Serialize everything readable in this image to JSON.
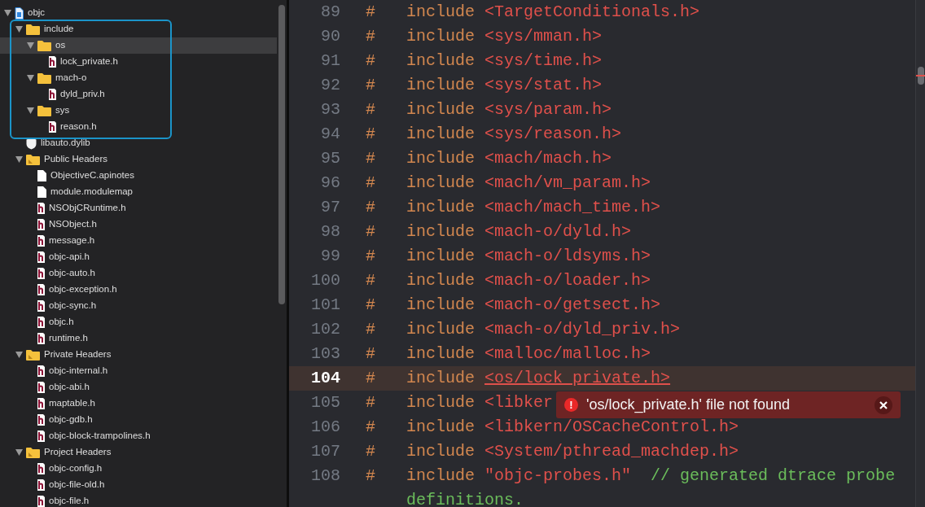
{
  "navigator": {
    "items": [
      {
        "label": "objc",
        "kind": "project",
        "expanded": true,
        "selected": false,
        "children": [
          {
            "label": "include",
            "kind": "folder",
            "expanded": true,
            "selected": false,
            "outlined": true,
            "children": [
              {
                "label": "os",
                "kind": "folder",
                "expanded": true,
                "selected": true,
                "children": [
                  {
                    "label": "lock_private.h",
                    "kind": "header",
                    "selected": false
                  }
                ]
              },
              {
                "label": "mach-o",
                "kind": "folder",
                "expanded": true,
                "selected": false,
                "children": [
                  {
                    "label": "dyld_priv.h",
                    "kind": "header",
                    "selected": false
                  }
                ]
              },
              {
                "label": "sys",
                "kind": "folder",
                "expanded": true,
                "selected": false,
                "children": [
                  {
                    "label": "reason.h",
                    "kind": "header",
                    "selected": false
                  }
                ]
              }
            ]
          },
          {
            "label": "libauto.dylib",
            "kind": "library",
            "selected": false
          },
          {
            "label": "Public Headers",
            "kind": "group",
            "expanded": true,
            "selected": false,
            "children": [
              {
                "label": "ObjectiveC.apinotes",
                "kind": "file",
                "selected": false
              },
              {
                "label": "module.modulemap",
                "kind": "file",
                "selected": false
              },
              {
                "label": "NSObjCRuntime.h",
                "kind": "header",
                "selected": false
              },
              {
                "label": "NSObject.h",
                "kind": "header",
                "selected": false
              },
              {
                "label": "message.h",
                "kind": "header",
                "selected": false
              },
              {
                "label": "objc-api.h",
                "kind": "header",
                "selected": false
              },
              {
                "label": "objc-auto.h",
                "kind": "header",
                "selected": false
              },
              {
                "label": "objc-exception.h",
                "kind": "header",
                "selected": false
              },
              {
                "label": "objc-sync.h",
                "kind": "header",
                "selected": false
              },
              {
                "label": "objc.h",
                "kind": "header",
                "selected": false
              },
              {
                "label": "runtime.h",
                "kind": "header",
                "selected": false
              }
            ]
          },
          {
            "label": "Private Headers",
            "kind": "group",
            "expanded": true,
            "selected": false,
            "children": [
              {
                "label": "objc-internal.h",
                "kind": "header",
                "selected": false
              },
              {
                "label": "objc-abi.h",
                "kind": "header",
                "selected": false
              },
              {
                "label": "maptable.h",
                "kind": "header",
                "selected": false
              },
              {
                "label": "objc-gdb.h",
                "kind": "header",
                "selected": false
              },
              {
                "label": "objc-block-trampolines.h",
                "kind": "header",
                "selected": false
              }
            ]
          },
          {
            "label": "Project Headers",
            "kind": "group",
            "expanded": true,
            "selected": false,
            "children": [
              {
                "label": "objc-config.h",
                "kind": "header",
                "selected": false
              },
              {
                "label": "objc-file-old.h",
                "kind": "header",
                "selected": false
              },
              {
                "label": "objc-file.h",
                "kind": "header",
                "selected": false
              }
            ]
          }
        ]
      }
    ]
  },
  "editor": {
    "lines": [
      {
        "number": "89",
        "hash": "#",
        "keyword": "include",
        "path": "<TargetConditionals.h>",
        "selected": false,
        "error": false
      },
      {
        "number": "90",
        "hash": "#",
        "keyword": "include",
        "path": "<sys/mman.h>",
        "selected": false,
        "error": false
      },
      {
        "number": "91",
        "hash": "#",
        "keyword": "include",
        "path": "<sys/time.h>",
        "selected": false,
        "error": false
      },
      {
        "number": "92",
        "hash": "#",
        "keyword": "include",
        "path": "<sys/stat.h>",
        "selected": false,
        "error": false
      },
      {
        "number": "93",
        "hash": "#",
        "keyword": "include",
        "path": "<sys/param.h>",
        "selected": false,
        "error": false
      },
      {
        "number": "94",
        "hash": "#",
        "keyword": "include",
        "path": "<sys/reason.h>",
        "selected": false,
        "error": false
      },
      {
        "number": "95",
        "hash": "#",
        "keyword": "include",
        "path": "<mach/mach.h>",
        "selected": false,
        "error": false
      },
      {
        "number": "96",
        "hash": "#",
        "keyword": "include",
        "path": "<mach/vm_param.h>",
        "selected": false,
        "error": false
      },
      {
        "number": "97",
        "hash": "#",
        "keyword": "include",
        "path": "<mach/mach_time.h>",
        "selected": false,
        "error": false
      },
      {
        "number": "98",
        "hash": "#",
        "keyword": "include",
        "path": "<mach-o/dyld.h>",
        "selected": false,
        "error": false
      },
      {
        "number": "99",
        "hash": "#",
        "keyword": "include",
        "path": "<mach-o/ldsyms.h>",
        "selected": false,
        "error": false
      },
      {
        "number": "100",
        "hash": "#",
        "keyword": "include",
        "path": "<mach-o/loader.h>",
        "selected": false,
        "error": false
      },
      {
        "number": "101",
        "hash": "#",
        "keyword": "include",
        "path": "<mach-o/getsect.h>",
        "selected": false,
        "error": false
      },
      {
        "number": "102",
        "hash": "#",
        "keyword": "include",
        "path": "<mach-o/dyld_priv.h>",
        "selected": false,
        "error": false
      },
      {
        "number": "103",
        "hash": "#",
        "keyword": "include",
        "path": "<malloc/malloc.h>",
        "selected": false,
        "error": false
      },
      {
        "number": "104",
        "hash": "#",
        "keyword": "include",
        "path": "<os/lock_private.h>",
        "selected": true,
        "error": true
      },
      {
        "number": "105",
        "hash": "#",
        "keyword": "include",
        "path": "<libker",
        "selected": false,
        "error": false
      },
      {
        "number": "106",
        "hash": "#",
        "keyword": "include",
        "path": "<libkern/OSCacheControl.h>",
        "selected": false,
        "error": false
      },
      {
        "number": "107",
        "hash": "#",
        "keyword": "include",
        "path": "<System/pthread_machdep.h>",
        "selected": false,
        "error": false
      },
      {
        "number": "108",
        "hash": "#",
        "keyword": "include",
        "path": "\"objc-probes.h\"",
        "comment": "// generated dtrace probe definitions.",
        "selected": false,
        "error": false
      }
    ],
    "error_popup": {
      "icon": "!",
      "message": "'os/lock_private.h' file not found"
    }
  }
}
